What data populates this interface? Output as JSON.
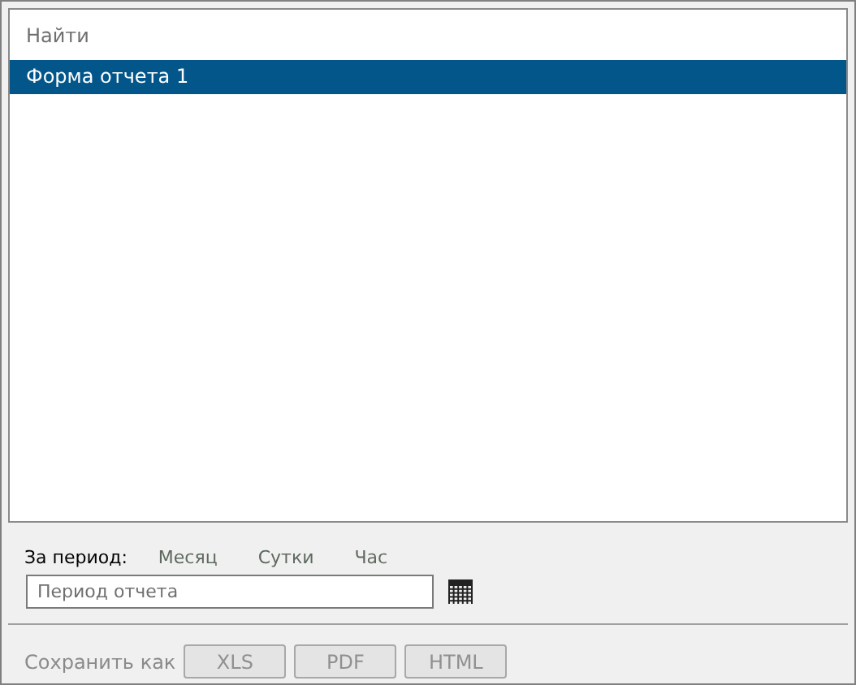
{
  "search": {
    "placeholder": "Найти"
  },
  "reports": [
    {
      "label": "Форма отчета 1",
      "selected": true
    }
  ],
  "period": {
    "label": "За период:",
    "options": [
      "Месяц",
      "Сутки",
      "Час"
    ],
    "field": {
      "placeholder": "Период отчета"
    }
  },
  "save": {
    "label": "Сохранить как",
    "buttons": [
      {
        "label": "XLS",
        "disabled": true
      },
      {
        "label": "PDF",
        "disabled": true
      },
      {
        "label": "HTML",
        "disabled": true
      }
    ]
  }
}
